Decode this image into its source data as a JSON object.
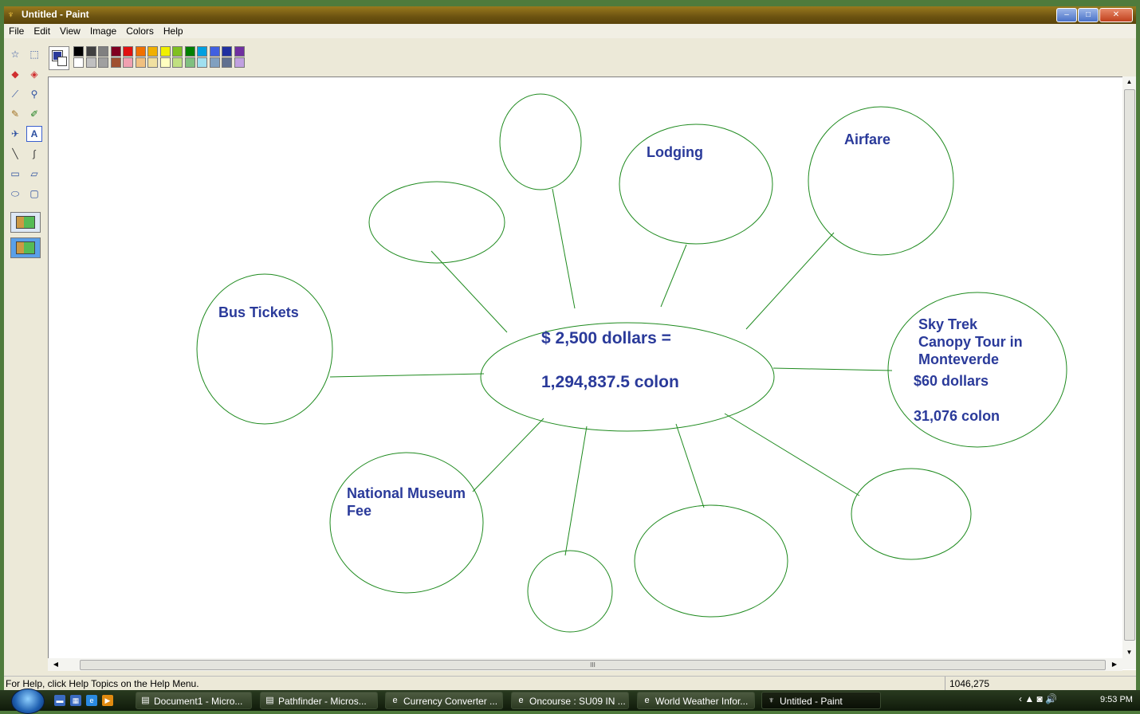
{
  "window": {
    "title": "Untitled - Paint",
    "buttons": {
      "minimize": "–",
      "maximize": "□",
      "close": "✕"
    }
  },
  "menu": [
    "File",
    "Edit",
    "View",
    "Image",
    "Colors",
    "Help"
  ],
  "palette": {
    "foreground": "#2a3a9a",
    "background": "#ffffff",
    "top_row": [
      "#000000",
      "#404040",
      "#808080",
      "#800020",
      "#e01010",
      "#f07000",
      "#f0b000",
      "#f0f000",
      "#80c020",
      "#008000",
      "#00a0e0",
      "#4060e0",
      "#2030a0",
      "#7030a0"
    ],
    "bottom_row": [
      "#ffffff",
      "#c0c0c0",
      "#a0a0a0",
      "#a05030",
      "#f0a0b0",
      "#f0c080",
      "#f0e0a0",
      "#ffffc0",
      "#c0e080",
      "#80c080",
      "#a0e0f0",
      "#80a0c0",
      "#607090",
      "#c0a0e0"
    ]
  },
  "tools": [
    "free-select-icon",
    "rect-select-icon",
    "eraser-icon",
    "fill-icon",
    "picker-icon",
    "magnifier-icon",
    "pencil-icon",
    "brush-icon",
    "airbrush-icon",
    "text-icon",
    "line-icon",
    "curve-icon",
    "rectangle-icon",
    "polygon-icon",
    "ellipse-icon",
    "rounded-rect-icon"
  ],
  "drawing": {
    "center_line1": "$ 2,500 dollars =",
    "center_line2": "1,294,837.5 colon",
    "lodging": "Lodging",
    "airfare": "Airfare",
    "bus_tickets": "Bus Tickets",
    "museum_line1": "National Museum",
    "museum_line2": "Fee",
    "skytrek_line1": "Sky Trek",
    "skytrek_line2": "Canopy Tour in",
    "skytrek_line3": "Monteverde",
    "skytrek_dollars": "$60 dollars",
    "skytrek_colon": "31,076 colon",
    "text_color": "#2a3a9a",
    "stroke_color": "#1e8a1e"
  },
  "hscroll_grip": "III",
  "status": {
    "help": "For Help, click Help Topics on the Help Menu.",
    "coords": "1046,275"
  },
  "taskbar": {
    "tasks": [
      "Document1 - Micro...",
      "Pathfinder - Micros...",
      "Currency Converter ...",
      "Oncourse : SU09 IN ...",
      "World Weather Infor...",
      "Untitled - Paint"
    ],
    "tray": "‹ ▲ ◙ 🔊",
    "clock": "9:53 PM"
  }
}
